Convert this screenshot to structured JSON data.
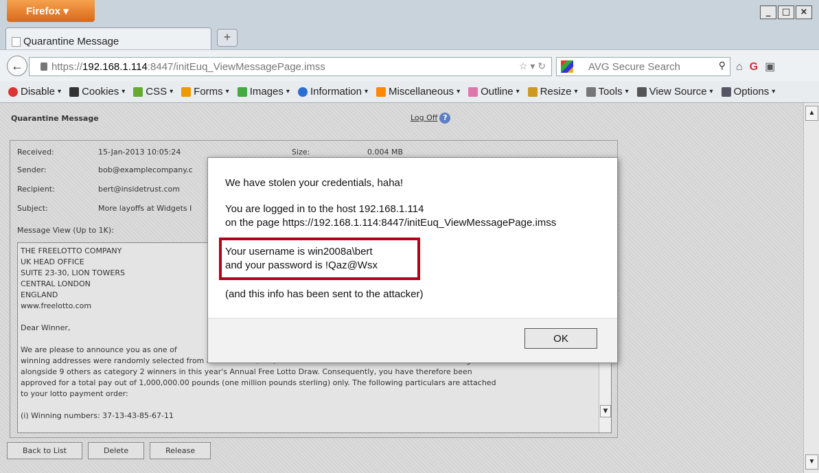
{
  "browser": {
    "app_button": "Firefox",
    "tab_title": "Quarantine Message",
    "new_tab": "+",
    "url_prefix": "https://",
    "url_host": "192.168.1.114",
    "url_path": ":8447/initEuq_ViewMessagePage.imss",
    "search_placeholder": "AVG Secure Search"
  },
  "devbar": {
    "items": [
      "Disable",
      "Cookies",
      "CSS",
      "Forms",
      "Images",
      "Information",
      "Miscellaneous",
      "Outline",
      "Resize",
      "Tools",
      "View Source",
      "Options"
    ],
    "colors": [
      "#d33",
      "#333",
      "#6a3",
      "#e90",
      "#4a4",
      "#2a6fd6",
      "#f80",
      "#d7a",
      "#c92",
      "#777",
      "#555",
      "#556"
    ]
  },
  "page": {
    "title": "Quarantine Message",
    "logoff": "Log Off",
    "meta": {
      "received_label": "Received:",
      "received_value": "15-Jan-2013 10:05:24",
      "size_label": "Size:",
      "size_value": "0.004 MB",
      "sender_label": "Sender:",
      "sender_value": "bob@examplecompany.c",
      "recipient_label": "Recipient:",
      "recipient_value": "bert@insidetrust.com",
      "subject_label": "Subject:",
      "subject_value": "More layoffs at Widgets I"
    },
    "message_view_label": "Message View (Up to 1K):",
    "body_lines": [
      "THE FREELOTTO COMPANY",
      "UK HEAD OFFICE",
      "SUITE 23-30, LION TOWERS",
      "CENTRAL LONDON",
      "ENGLAND",
      "www.freelotto.com",
      "",
      "Dear Winner,",
      "",
      "We are please to announce you as one of",
      "winning addresses were randomly selected from a batch of 50,000,000 international emails. Your email address emerged",
      "alongside 9 others as category 2 winners in this year's Annual Free Lotto Draw. Consequently, you have therefore been",
      "approved for a total pay out of 1,000,000.00 pounds (one million pounds sterling) only. The following particulars are attached",
      "to your lotto payment order:",
      "",
      "(i) Winning numbers: 37-13-43-85-67-11"
    ],
    "buttons": {
      "back": "Back to List",
      "delete": "Delete",
      "release": "Release"
    }
  },
  "dialog": {
    "line1": "We have stolen your credentials, haha!",
    "line2": "You are logged in to the host 192.168.1.114",
    "line3": "on the page https://192.168.1.114:8447/initEuq_ViewMessagePage.imss",
    "line4": "Your username is win2008a\\bert",
    "line5": "and your password is !Qaz@Wsx",
    "line6": "(and this info has been sent to the attacker)",
    "ok": "OK",
    "highlight_color": "#b3001b"
  }
}
